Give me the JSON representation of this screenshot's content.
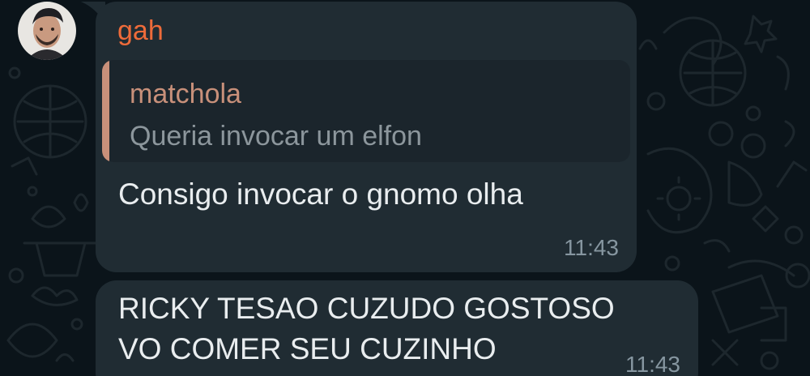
{
  "colors": {
    "background": "#0b141a",
    "bubble": "#202c33",
    "quote_background": "#1b252c",
    "sender_name": "#ee6b3a",
    "quote_accent": "#c8907a",
    "message_text": "#e9edef",
    "timestamp": "#8696a0"
  },
  "messages": [
    {
      "sender": "gah",
      "quoted": {
        "author": "matchola",
        "text": "Queria invocar um elfon"
      },
      "text": "Consigo invocar o gnomo olha",
      "time": "11:43"
    },
    {
      "lines": [
        "RICKY TESAO CUZUDO GOSTOSO",
        "VO COMER SEU CUZINHO"
      ],
      "time": "11:43"
    }
  ]
}
